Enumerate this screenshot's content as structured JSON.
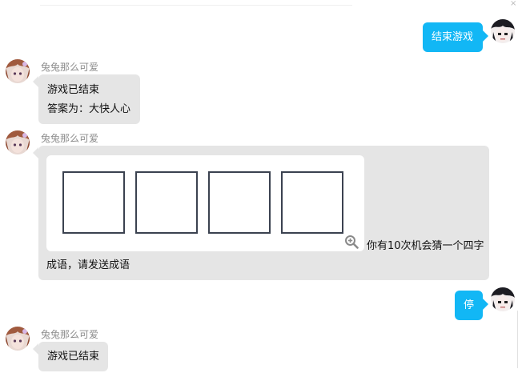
{
  "header": {
    "scroll_glyph": "×"
  },
  "messages": [
    {
      "id": "m1",
      "side": "right",
      "text": "结束游戏"
    },
    {
      "id": "m2",
      "side": "left",
      "sender": "兔兔那么可爱",
      "lines": [
        "游戏已结束",
        "答案为：大快人心"
      ]
    },
    {
      "id": "m3",
      "side": "left",
      "sender": "兔兔那么可爱",
      "puzzle": {
        "cell_count": 4,
        "zoom_icon": "zoom-in-icon"
      },
      "inline_text": "你有10次机会猜一个四字",
      "continued_text": "成语，请发送成语"
    },
    {
      "id": "m4",
      "side": "right",
      "text": "停"
    },
    {
      "id": "m5",
      "side": "left",
      "sender": "兔兔那么可爱",
      "lines": [
        "游戏已结束"
      ]
    }
  ],
  "colors": {
    "received_bubble": "#e5e5e5",
    "sent_bubble": "#12b7f5",
    "sender_name": "#8c8c8c",
    "cell_border": "#3b4250"
  }
}
